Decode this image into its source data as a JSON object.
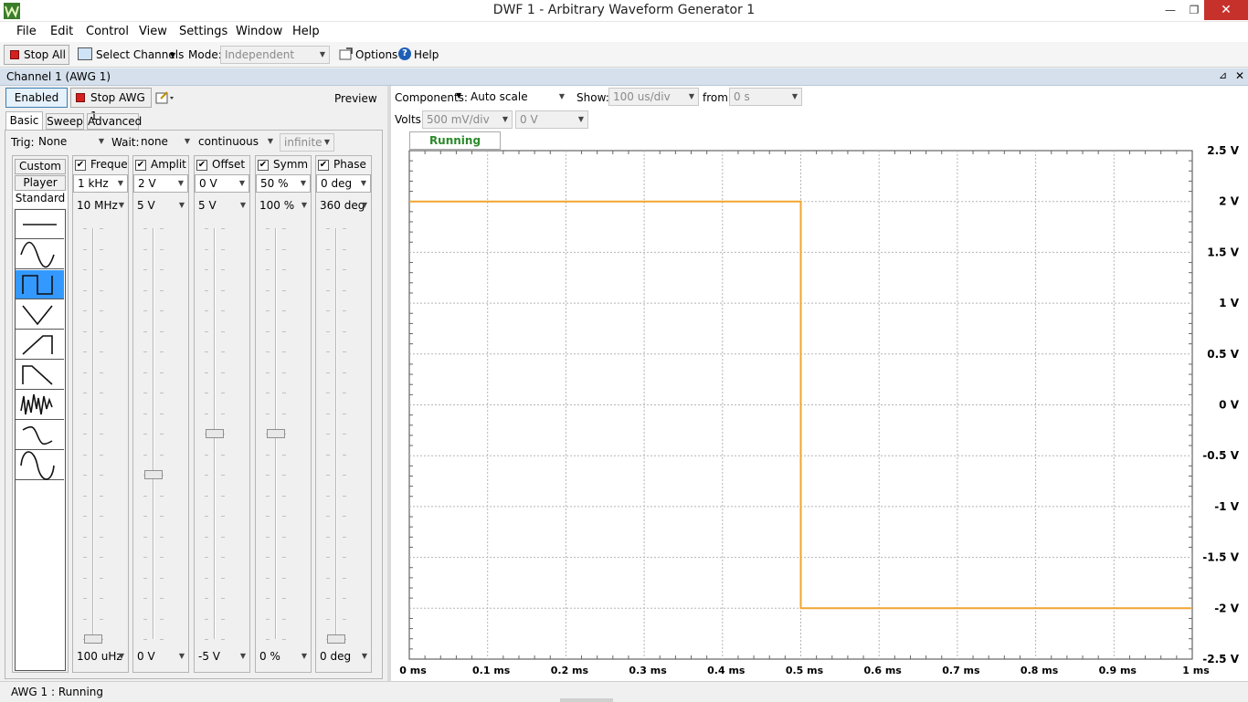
{
  "window": {
    "title": "DWF 1 - Arbitrary Waveform Generator 1",
    "close_glyph": "✕",
    "minimize_glyph": "—",
    "restore_glyph": "❐"
  },
  "menu": [
    "File",
    "Edit",
    "Control",
    "View",
    "Settings",
    "Window",
    "Help"
  ],
  "toolbar": {
    "stop_all": "Stop All",
    "select_channels": "Select Channels",
    "mode_label": "Mode:",
    "mode_value": "Independent",
    "options": "Options",
    "help": "Help"
  },
  "channel_title": "Channel 1 (AWG 1)",
  "channel": {
    "enabled": "Enabled",
    "stop_awg": "Stop AWG 1",
    "preview": "Preview",
    "tabs": [
      "Basic",
      "Sweep",
      "Advanced"
    ],
    "trig_label": "Trig:",
    "trig_value": "None",
    "wait_label": "Wait:",
    "wait_value": "none",
    "run_mode": "continuous",
    "repeat": "infinite",
    "side_tabs": [
      "Custom",
      "Player",
      "Standard"
    ],
    "waveforms": [
      "dc-icon",
      "sine-icon",
      "square-icon",
      "triangle-icon",
      "ramp-up-icon",
      "ramp-down-icon",
      "noise-icon",
      "trapezium-icon",
      "sine-power-icon"
    ],
    "selected_waveform": 2
  },
  "params": [
    {
      "name": "Freque",
      "value": "1 kHz",
      "max": "10 MHz",
      "min": "100 uHz",
      "level": 0.0
    },
    {
      "name": "Amplit",
      "value": "2 V",
      "max": "5 V",
      "min": "0 V",
      "level": 0.4
    },
    {
      "name": "Offset",
      "value": "0 V",
      "max": "5 V",
      "min": "-5 V",
      "level": 0.5
    },
    {
      "name": "Symm",
      "value": "50 %",
      "max": "100 %",
      "min": "0 %",
      "level": 0.5
    },
    {
      "name": "Phase",
      "value": "0 deg",
      "max": "360 deg",
      "min": "0 deg",
      "level": 0.0
    }
  ],
  "plot": {
    "components_label": "Components:",
    "components_value": "Auto scale",
    "show_label": "Show:",
    "show_value": "100 us/div",
    "from_label": "from:",
    "from_value": "0 s",
    "volts_label": "Volts:",
    "volts_value": "500 mV/div",
    "volts_offset": "0 V",
    "running": "Running",
    "trace_color": "#f0a530",
    "y_ticks": [
      "2.5 V",
      "2 V",
      "1.5 V",
      "1 V",
      "0.5 V",
      "0 V",
      "-0.5 V",
      "-1 V",
      "-1.5 V",
      "-2 V",
      "-2.5 V"
    ],
    "x_ticks": [
      "0 ms",
      "0.1 ms",
      "0.2 ms",
      "0.3 ms",
      "0.4 ms",
      "0.5 ms",
      "0.6 ms",
      "0.7 ms",
      "0.8 ms",
      "0.9 ms",
      "1 ms"
    ]
  },
  "chart_data": {
    "type": "line",
    "x": [
      0,
      0.5,
      0.5,
      1.0
    ],
    "y": [
      2,
      2,
      -2,
      -2
    ],
    "xlim": [
      0,
      1
    ],
    "ylim": [
      -2.5,
      2.5
    ],
    "grid": true
  },
  "status": "AWG 1 : Running"
}
